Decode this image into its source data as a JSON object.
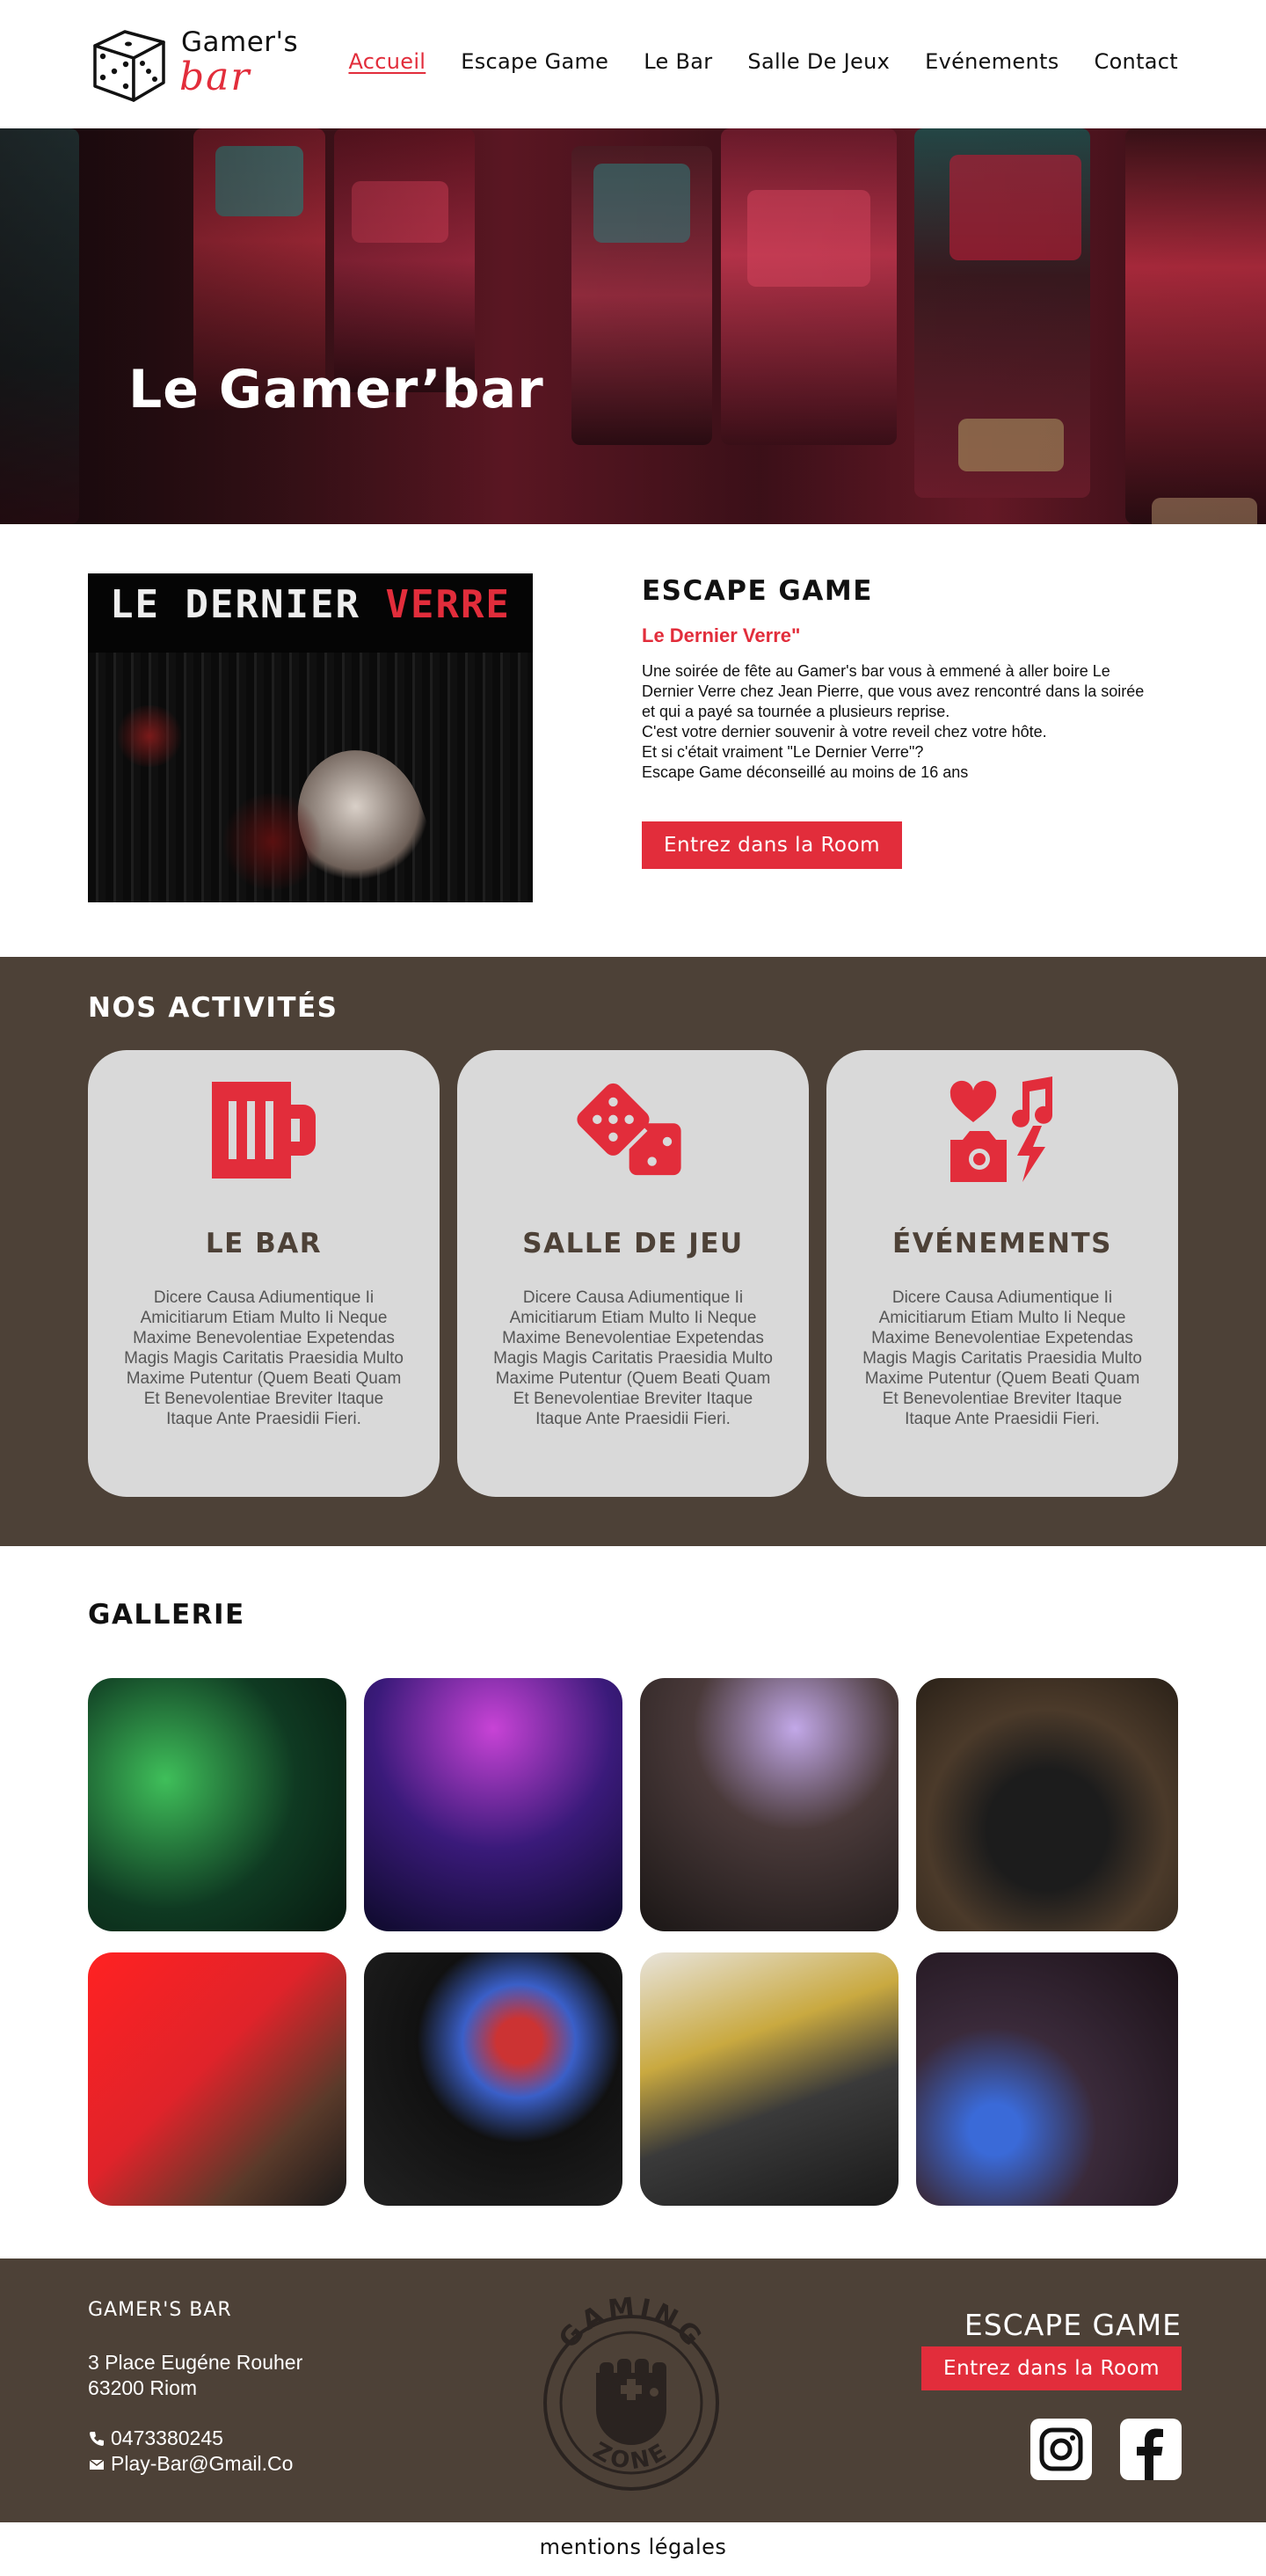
{
  "logo": {
    "line1": "Gamer's",
    "line2": "bar"
  },
  "nav": {
    "items": [
      {
        "label": "Accueil",
        "active": true
      },
      {
        "label": "Escape Game"
      },
      {
        "label": "Le Bar"
      },
      {
        "label": "Salle De Jeux"
      },
      {
        "label": "Evénements"
      },
      {
        "label": "Contact"
      }
    ]
  },
  "hero": {
    "title": "Le Gamer’bar"
  },
  "escape": {
    "image_text_1": "LE DERNIER",
    "image_text_2": "VERRE",
    "heading": "ESCAPE GAME",
    "subtitle": "Le Dernier Verre\"",
    "description": [
      "Une soirée de fête au Gamer's bar vous à emmené à aller boire Le Dernier Verre chez Jean Pierre, que vous avez rencontré dans la soirée et qui a payé sa tournée a plusieurs reprise.",
      "C'est votre dernier souvenir à votre reveil chez votre hôte.",
      "Et si c'était vraiment \"Le Dernier Verre\"?",
      "Escape Game déconseillé au moins de 16 ans"
    ],
    "button": "Entrez dans la Room"
  },
  "activities": {
    "title": "NOS ACTIVITÉS",
    "cards": [
      {
        "title": "LE BAR",
        "icon": "beer-mug-icon",
        "text": "Dicere Causa Adiumentique Ii Amicitiarum Etiam Multo Ii Neque Maxime Benevolentiae Expetendas Magis Magis Caritatis Praesidia Multo Maxime Putentur (Quem Beati Quam Et Benevolentiae Breviter Itaque Itaque Ante Praesidii Fieri."
      },
      {
        "title": "SALLE DE JEU",
        "icon": "dice-icon",
        "text": "Dicere Causa Adiumentique Ii Amicitiarum Etiam Multo Ii Neque Maxime Benevolentiae Expetendas Magis Magis Caritatis Praesidia Multo Maxime Putentur (Quem Beati Quam Et Benevolentiae Breviter Itaque Itaque Ante Praesidii Fieri."
      },
      {
        "title": "ÉVÉNEMENTS",
        "icon": "events-icon",
        "text": "Dicere Causa Adiumentique Ii Amicitiarum Etiam Multo Ii Neque Maxime Benevolentiae Expetendas Magis Magis Caritatis Praesidia Multo Maxime Putentur (Quem Beati Quam Et Benevolentiae Breviter Itaque Itaque Ante Praesidii Fieri."
      }
    ]
  },
  "gallery": {
    "title": "GALLERIE"
  },
  "footer": {
    "name": "GAMER'S BAR",
    "address_line1": "3 Place Eugéne Rouher",
    "address_line2": "63200 Riom",
    "phone": "0473380245",
    "email": "Play-Bar@Gmail.Co",
    "logo_top": "GAMING",
    "logo_bottom": "ZONE",
    "escape_title": "ESCAPE GAME",
    "button": "Entrez dans la Room"
  },
  "legal": "mentions légales",
  "colors": {
    "accent": "#e22d3b",
    "brown": "#4d4137",
    "card": "#d9d9d9"
  }
}
